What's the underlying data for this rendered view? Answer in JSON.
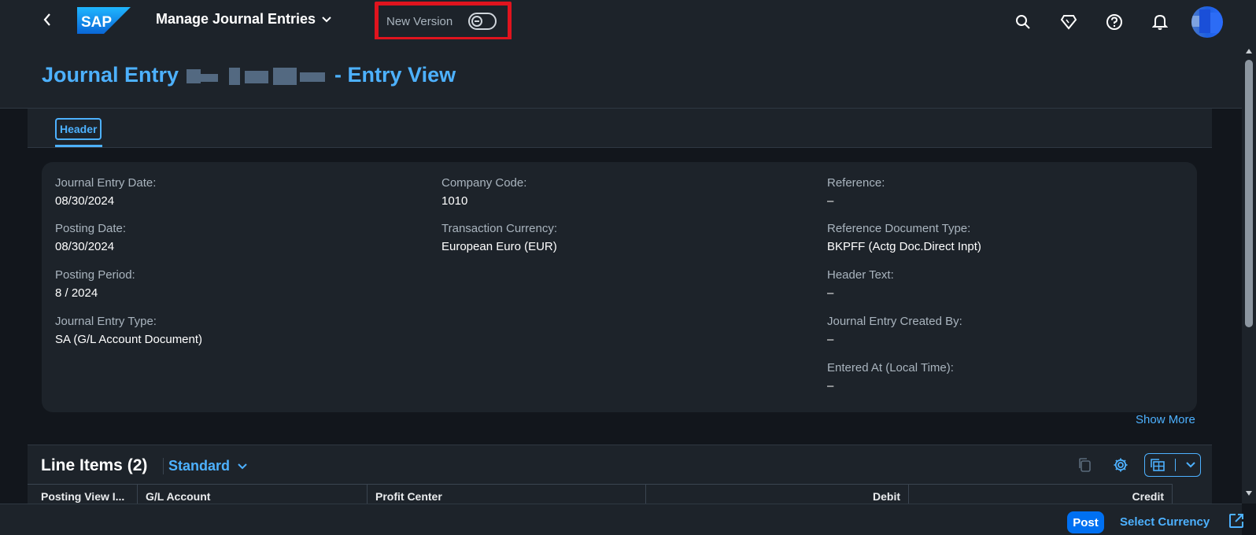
{
  "shell": {
    "app_title": "Manage Journal Entries",
    "new_version_label": "New Version",
    "icons": [
      "search-icon",
      "diamond-icon",
      "help-icon",
      "bell-icon"
    ]
  },
  "page": {
    "title_prefix": "Journal Entry",
    "title_suffix": "- Entry View"
  },
  "tabs": [
    {
      "label": "Header"
    }
  ],
  "header_fields": {
    "col1": [
      {
        "label": "Journal Entry Date:",
        "value": "08/30/2024"
      },
      {
        "label": "Posting Date:",
        "value": "08/30/2024"
      },
      {
        "label": "Posting Period:",
        "value": "8 / 2024"
      },
      {
        "label": "Journal Entry Type:",
        "value": "SA (G/L Account Document)"
      }
    ],
    "col2": [
      {
        "label": "Company Code:",
        "value": "1010"
      },
      {
        "label": "Transaction Currency:",
        "value": "European Euro (EUR)"
      }
    ],
    "col3": [
      {
        "label": "Reference:",
        "value": "–"
      },
      {
        "label": "Reference Document Type:",
        "value": "BKPFF (Actg Doc.Direct Inpt)"
      },
      {
        "label": "Header Text:",
        "value": "–"
      },
      {
        "label": "Journal Entry Created By:",
        "value": "–"
      },
      {
        "label": "Entered At (Local Time):",
        "value": "–"
      }
    ],
    "show_more": "Show More"
  },
  "line_items": {
    "title": "Line Items (2)",
    "variant": "Standard",
    "columns": [
      "Posting View I...",
      "G/L Account",
      "Profit Center",
      "Debit",
      "Credit"
    ]
  },
  "footer": {
    "post_label": "Post",
    "select_currency_label": "Select Currency"
  },
  "colors": {
    "accent": "#4db1ff",
    "highlight_border": "#e0141e",
    "emphasized_button": "#0070f2"
  }
}
